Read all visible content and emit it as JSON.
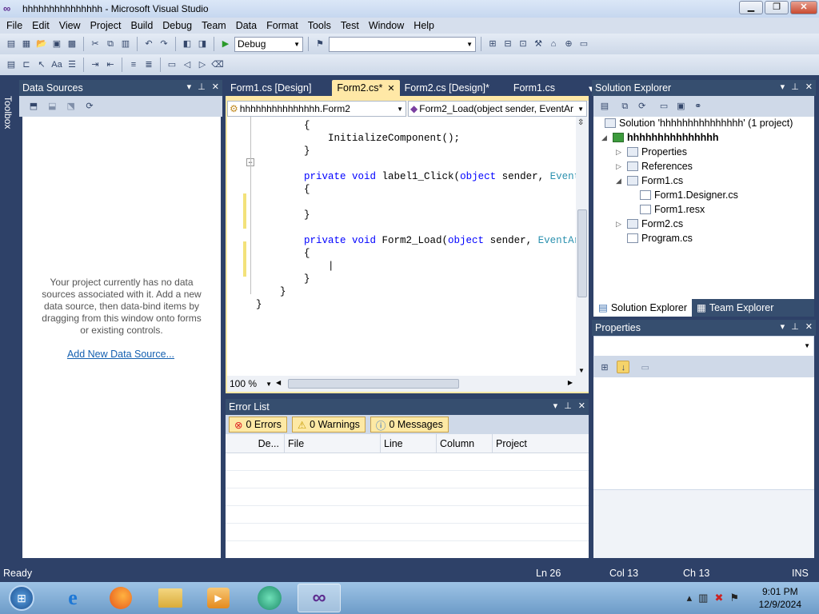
{
  "window": {
    "title": "hhhhhhhhhhhhhhh - Microsoft Visual Studio",
    "minimize": "▁",
    "restore": "❐",
    "close": "✕"
  },
  "menu": [
    "File",
    "Edit",
    "View",
    "Project",
    "Build",
    "Debug",
    "Team",
    "Data",
    "Format",
    "Tools",
    "Test",
    "Window",
    "Help"
  ],
  "toolbar": {
    "config": "Debug",
    "platform": ""
  },
  "data_sources": {
    "title": "Data Sources",
    "message": "Your project currently has no data sources associated with it. Add a new data source, then data-bind items by dragging from this window onto forms or existing controls.",
    "link": "Add New Data Source..."
  },
  "toolbox_label": "Toolbox",
  "editor": {
    "tabs": [
      {
        "label": "Form1.cs [Design]",
        "active": false
      },
      {
        "label": "Form2.cs*",
        "active": true
      },
      {
        "label": "Form2.cs [Design]*",
        "active": false
      },
      {
        "label": "Form1.cs",
        "active": false
      }
    ],
    "class_combo": "hhhhhhhhhhhhhhh.Form2",
    "member_combo": "Form2_Load(object sender, EventAr",
    "code": [
      {
        "parts": [
          {
            "t": "        {",
            "c": ""
          }
        ]
      },
      {
        "parts": [
          {
            "t": "            InitializeComponent();",
            "c": ""
          }
        ]
      },
      {
        "parts": [
          {
            "t": "        }",
            "c": ""
          }
        ]
      },
      {
        "parts": [
          {
            "t": "",
            "c": ""
          }
        ]
      },
      {
        "parts": [
          {
            "t": "        ",
            "c": ""
          },
          {
            "t": "private void",
            "c": "kw"
          },
          {
            "t": " label1_Click(",
            "c": ""
          },
          {
            "t": "object",
            "c": "kw"
          },
          {
            "t": " sender, ",
            "c": ""
          },
          {
            "t": "EventArgs",
            "c": "ty"
          }
        ]
      },
      {
        "parts": [
          {
            "t": "        {",
            "c": ""
          }
        ]
      },
      {
        "parts": [
          {
            "t": "",
            "c": ""
          }
        ]
      },
      {
        "parts": [
          {
            "t": "        }",
            "c": ""
          }
        ]
      },
      {
        "parts": [
          {
            "t": "",
            "c": ""
          }
        ]
      },
      {
        "parts": [
          {
            "t": "        ",
            "c": ""
          },
          {
            "t": "private void",
            "c": "kw"
          },
          {
            "t": " Form2_Load(",
            "c": ""
          },
          {
            "t": "object",
            "c": "kw"
          },
          {
            "t": " sender, ",
            "c": ""
          },
          {
            "t": "EventArgs",
            "c": "ty"
          },
          {
            "t": " e)",
            "c": ""
          }
        ]
      },
      {
        "parts": [
          {
            "t": "        {",
            "c": ""
          }
        ]
      },
      {
        "parts": [
          {
            "t": "            |",
            "c": ""
          }
        ]
      },
      {
        "parts": [
          {
            "t": "        }",
            "c": ""
          }
        ]
      },
      {
        "parts": [
          {
            "t": "    }",
            "c": ""
          }
        ]
      },
      {
        "parts": [
          {
            "t": "}",
            "c": ""
          }
        ]
      }
    ],
    "zoom": "100 %"
  },
  "error_list": {
    "title": "Error List",
    "errors": "0 Errors",
    "warnings": "0 Warnings",
    "messages": "0 Messages",
    "columns": [
      "De...",
      "File",
      "Line",
      "Column",
      "Project"
    ]
  },
  "solution_explorer": {
    "title": "Solution Explorer",
    "items": [
      {
        "label": "Solution 'hhhhhhhhhhhhhhh' (1 project)",
        "exp": ""
      },
      {
        "label": "hhhhhhhhhhhhhhh",
        "exp": "◢"
      },
      {
        "label": "Properties",
        "exp": "▷"
      },
      {
        "label": "References",
        "exp": "▷"
      },
      {
        "label": "Form1.cs",
        "exp": "◢"
      },
      {
        "label": "Form1.Designer.cs",
        "exp": ""
      },
      {
        "label": "Form1.resx",
        "exp": ""
      },
      {
        "label": "Form2.cs",
        "exp": "▷"
      },
      {
        "label": "Program.cs",
        "exp": ""
      }
    ],
    "tab_se": "Solution Explorer",
    "tab_te": "Team Explorer"
  },
  "properties": {
    "title": "Properties"
  },
  "status": {
    "ready": "Ready",
    "ln": "Ln 26",
    "col": "Col 13",
    "ch": "Ch 13",
    "ins": "INS"
  },
  "clock": {
    "time": "9:01 PM",
    "date": "12/9/2024"
  }
}
